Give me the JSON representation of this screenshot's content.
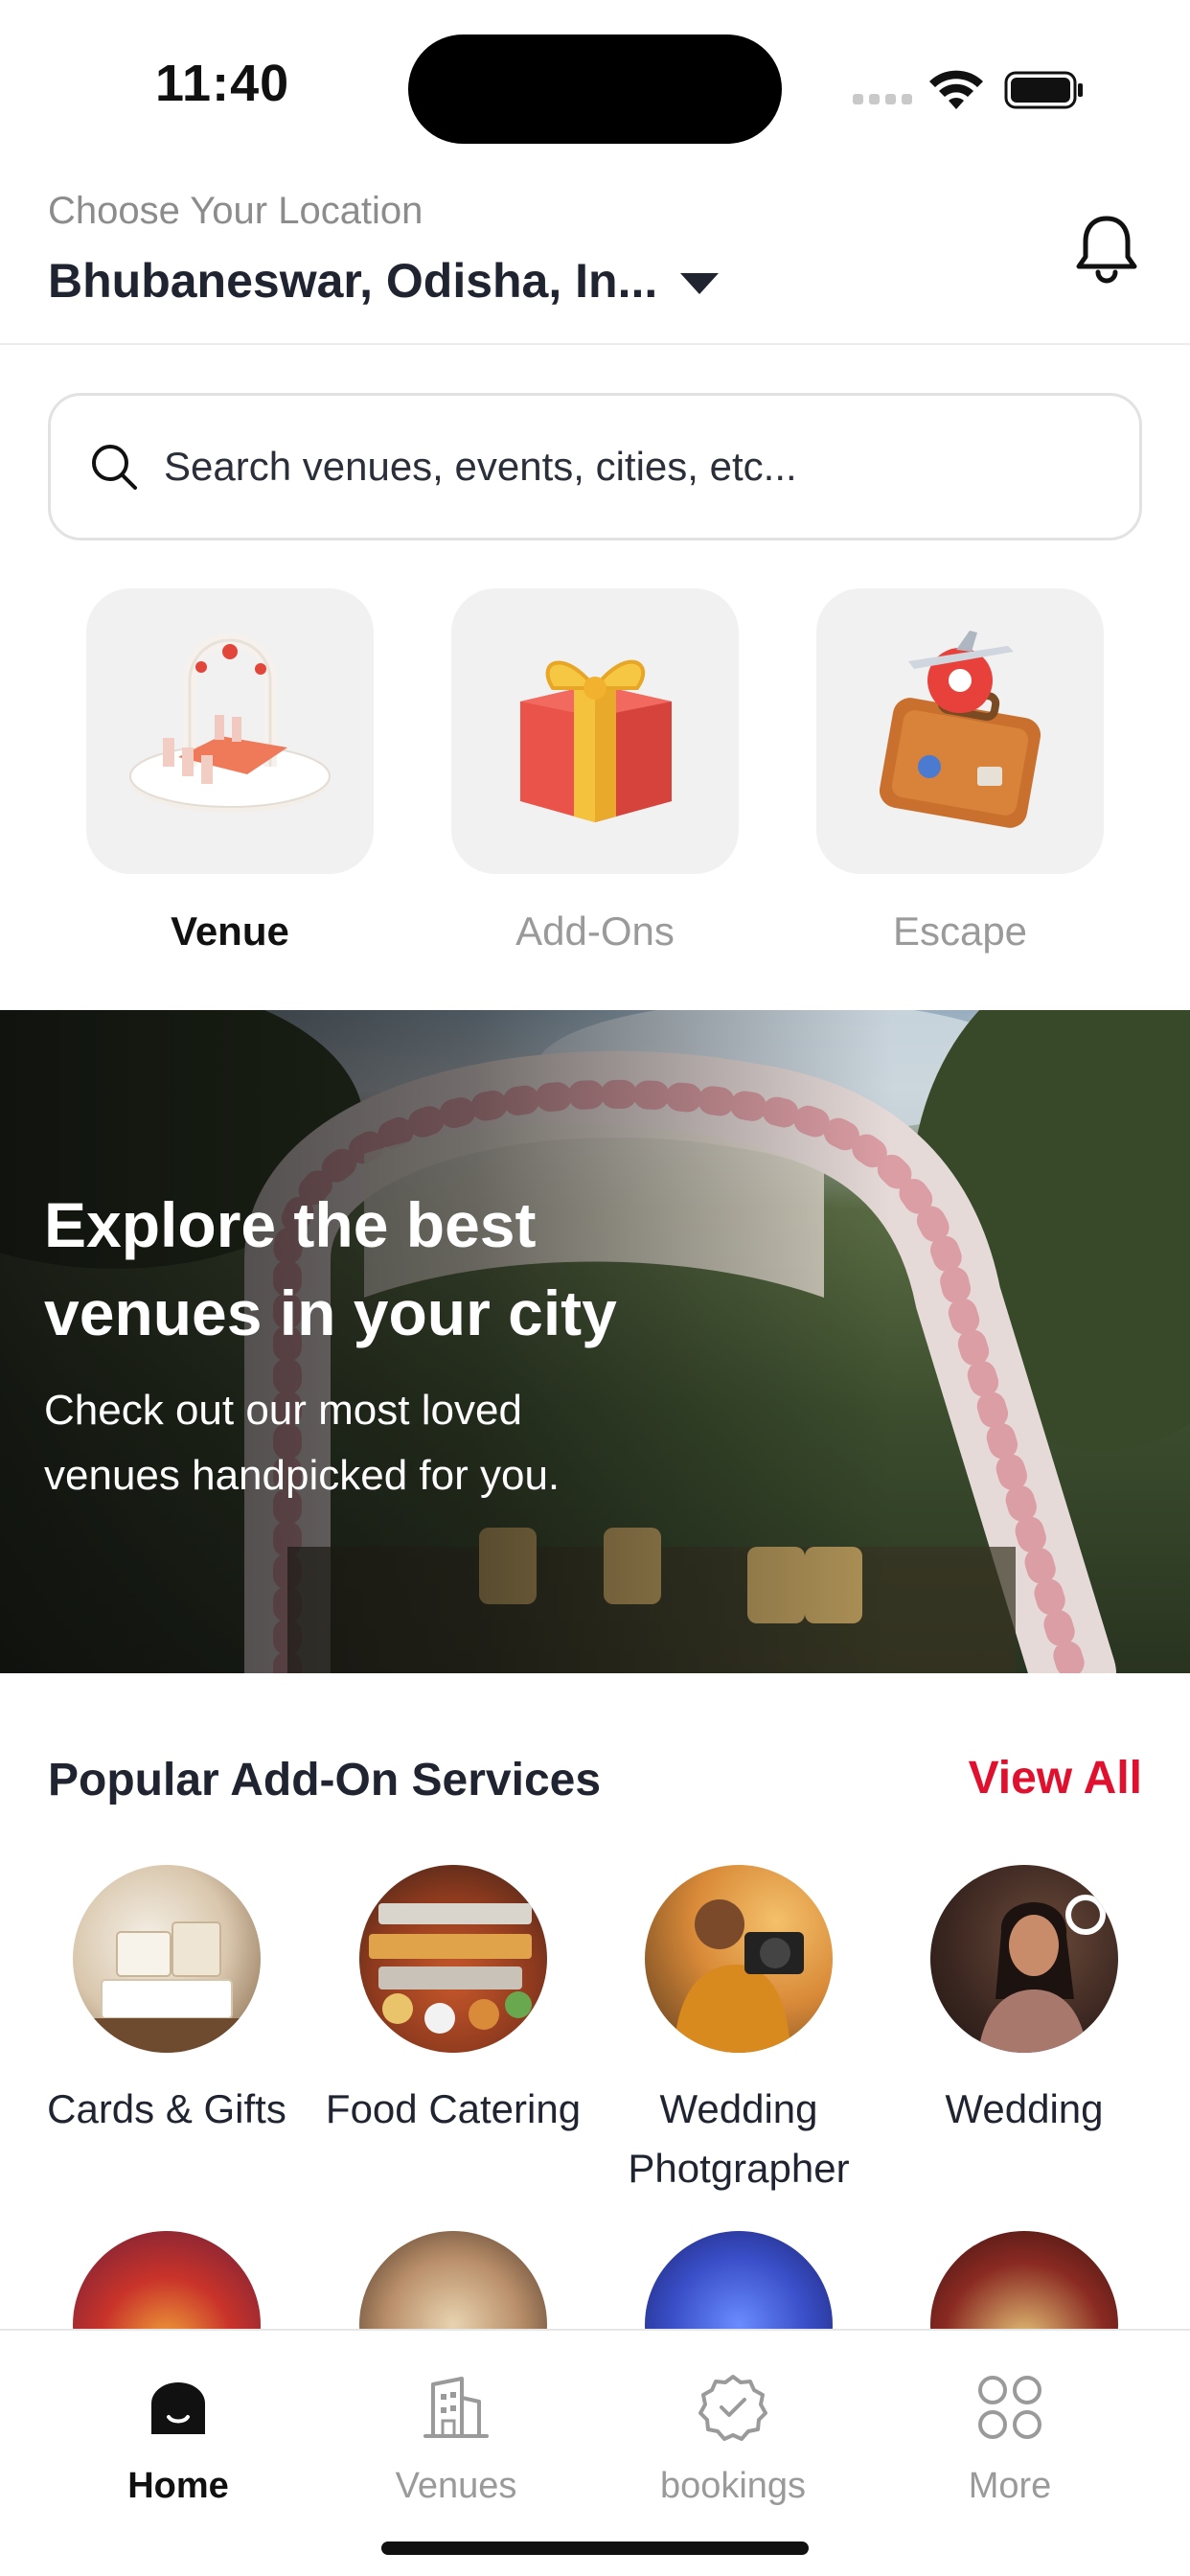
{
  "status_bar": {
    "time": "11:40"
  },
  "header": {
    "location_label": "Choose Your Location",
    "location_value": "Bhubaneswar, Odisha, In..."
  },
  "search": {
    "placeholder": "Search venues, events, cities, etc..."
  },
  "categories": [
    {
      "label": "Venue",
      "selected": true,
      "icon": "venue-arch-icon"
    },
    {
      "label": "Add-Ons",
      "selected": false,
      "icon": "gift-icon"
    },
    {
      "label": "Escape",
      "selected": false,
      "icon": "suitcase-icon"
    }
  ],
  "banner": {
    "title": "Explore the best venues in your city",
    "subtitle": "Check out our most loved venues handpicked for you."
  },
  "popular": {
    "title": "Popular Add-On Services",
    "view_all": "View All",
    "items": [
      {
        "label": "Cards & Gifts"
      },
      {
        "label": "Food Catering"
      },
      {
        "label": "Wedding Photgrapher"
      },
      {
        "label": "Wedding"
      }
    ]
  },
  "tabs": [
    {
      "label": "Home",
      "active": true,
      "icon": "home-icon"
    },
    {
      "label": "Venues",
      "active": false,
      "icon": "building-icon"
    },
    {
      "label": "bookings",
      "active": false,
      "icon": "badge-check-icon"
    },
    {
      "label": "More",
      "active": false,
      "icon": "grid-icon"
    }
  ],
  "colors": {
    "accent": "#e0102f",
    "text": "#1f2430",
    "muted": "#9a9a9a",
    "tile": "#f1f1f1"
  }
}
